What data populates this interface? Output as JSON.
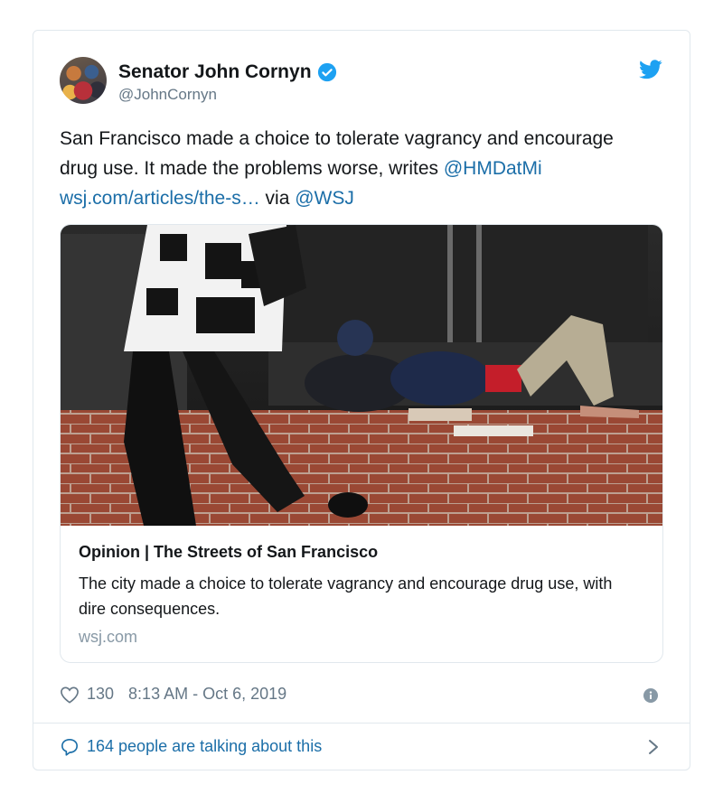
{
  "tweet": {
    "display_name": "Senator John Cornyn",
    "handle": "@JohnCornyn",
    "text_part1": "San Francisco made a choice to tolerate vagrancy and encourage drug use. It made the problems worse, writes ",
    "mention_author": "@HMDatMi",
    "link_text": "wsj.com/articles/the-s…",
    "text_via": " via ",
    "mention_source": "@WSJ"
  },
  "card": {
    "title": "Opinion | The Streets of San Francisco",
    "description": "The city made a choice to tolerate vagrancy and encourage drug use, with dire consequences.",
    "domain": "wsj.com"
  },
  "meta": {
    "likes": "130",
    "timestamp": "8:13 AM - Oct 6, 2019"
  },
  "footer": {
    "talking": "164 people are talking about this"
  },
  "icons": {
    "verified": "verified-badge-icon",
    "logo": "twitter-bird-icon",
    "like": "heart-icon",
    "info": "info-icon",
    "reply": "speech-bubble-icon",
    "more": "chevron-right-icon"
  },
  "colors": {
    "link": "#1b6ea8",
    "twitter_blue": "#1da1f2",
    "secondary_text": "#657786"
  }
}
